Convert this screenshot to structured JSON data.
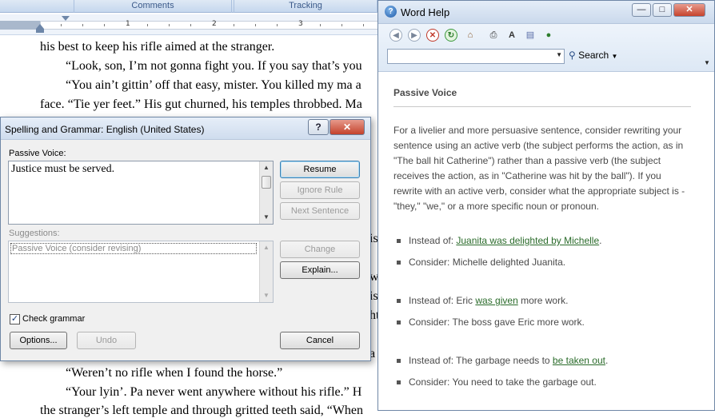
{
  "ribbon": {
    "tabs": [
      "Comments",
      "Tracking"
    ]
  },
  "ruler": {
    "numbers": [
      "1",
      "2",
      "3"
    ]
  },
  "document": {
    "lines": [
      "his best to keep his rifle aimed at the stranger.",
      "“Look, son, I’m not gonna fight you. If you say that’s you",
      "“You ain’t gittin’ off that easy, mister. You killed my ma a",
      "face. “Tie yer feet.” His gut churned, his temples throbbed. Ma",
      "“Weren’t no rifle when I found the horse.”",
      "“Your lyin’. Pa never went anywhere without his rifle.” H",
      "the stranger’s left temple and through gritted teeth said, “When"
    ],
    "peek_right": [
      "is",
      "w",
      "is",
      "ht",
      "a"
    ]
  },
  "spelling_dialog": {
    "title": "Spelling and Grammar: English (United States)",
    "help_button": "?",
    "close_button": "✕",
    "issue_label": "Passive Voice:",
    "issue_text": "Justice must be served.",
    "suggestions_label": "Suggestions:",
    "suggestion_item": "Passive Voice (consider revising)",
    "buttons": {
      "resume": "Resume",
      "ignore_rule": "Ignore Rule",
      "next_sentence": "Next Sentence",
      "change": "Change",
      "explain": "Explain...",
      "options": "Options...",
      "undo": "Undo",
      "cancel": "Cancel"
    },
    "check_grammar_label": "Check grammar",
    "check_grammar_checked": true
  },
  "word_help": {
    "title": "Word Help",
    "window_buttons": {
      "minimize": "—",
      "maximize": "□",
      "close": "✕"
    },
    "search_value": "",
    "search_label": "Search",
    "heading": "Passive Voice",
    "paragraph": "For a livelier and more persuasive sentence, consider rewriting your sentence using an active verb (the subject performs the action, as in \"The ball hit Catherine\") rather than a passive verb (the subject receives the action, as in \"Catherine was hit by the ball\"). If you rewrite with an active verb, consider what the appropriate subject is - \"they,\" \"we,\" or a more specific noun or pronoun.",
    "examples": [
      {
        "prefix": "Instead of: ",
        "pre_link": "",
        "link": "Juanita was delighted by Michelle",
        "suffix": "."
      },
      {
        "prefix": "Consider: Michelle delighted Juanita."
      },
      {
        "prefix": "Instead of: ",
        "pre_link": "Eric ",
        "link": "was given",
        "suffix": " more work."
      },
      {
        "prefix": "Consider: The boss gave Eric more work."
      },
      {
        "prefix": "Instead of: ",
        "pre_link": "The garbage needs to ",
        "link": "be taken out",
        "suffix": "."
      },
      {
        "prefix": "Consider: You need to take the garbage out."
      }
    ]
  }
}
